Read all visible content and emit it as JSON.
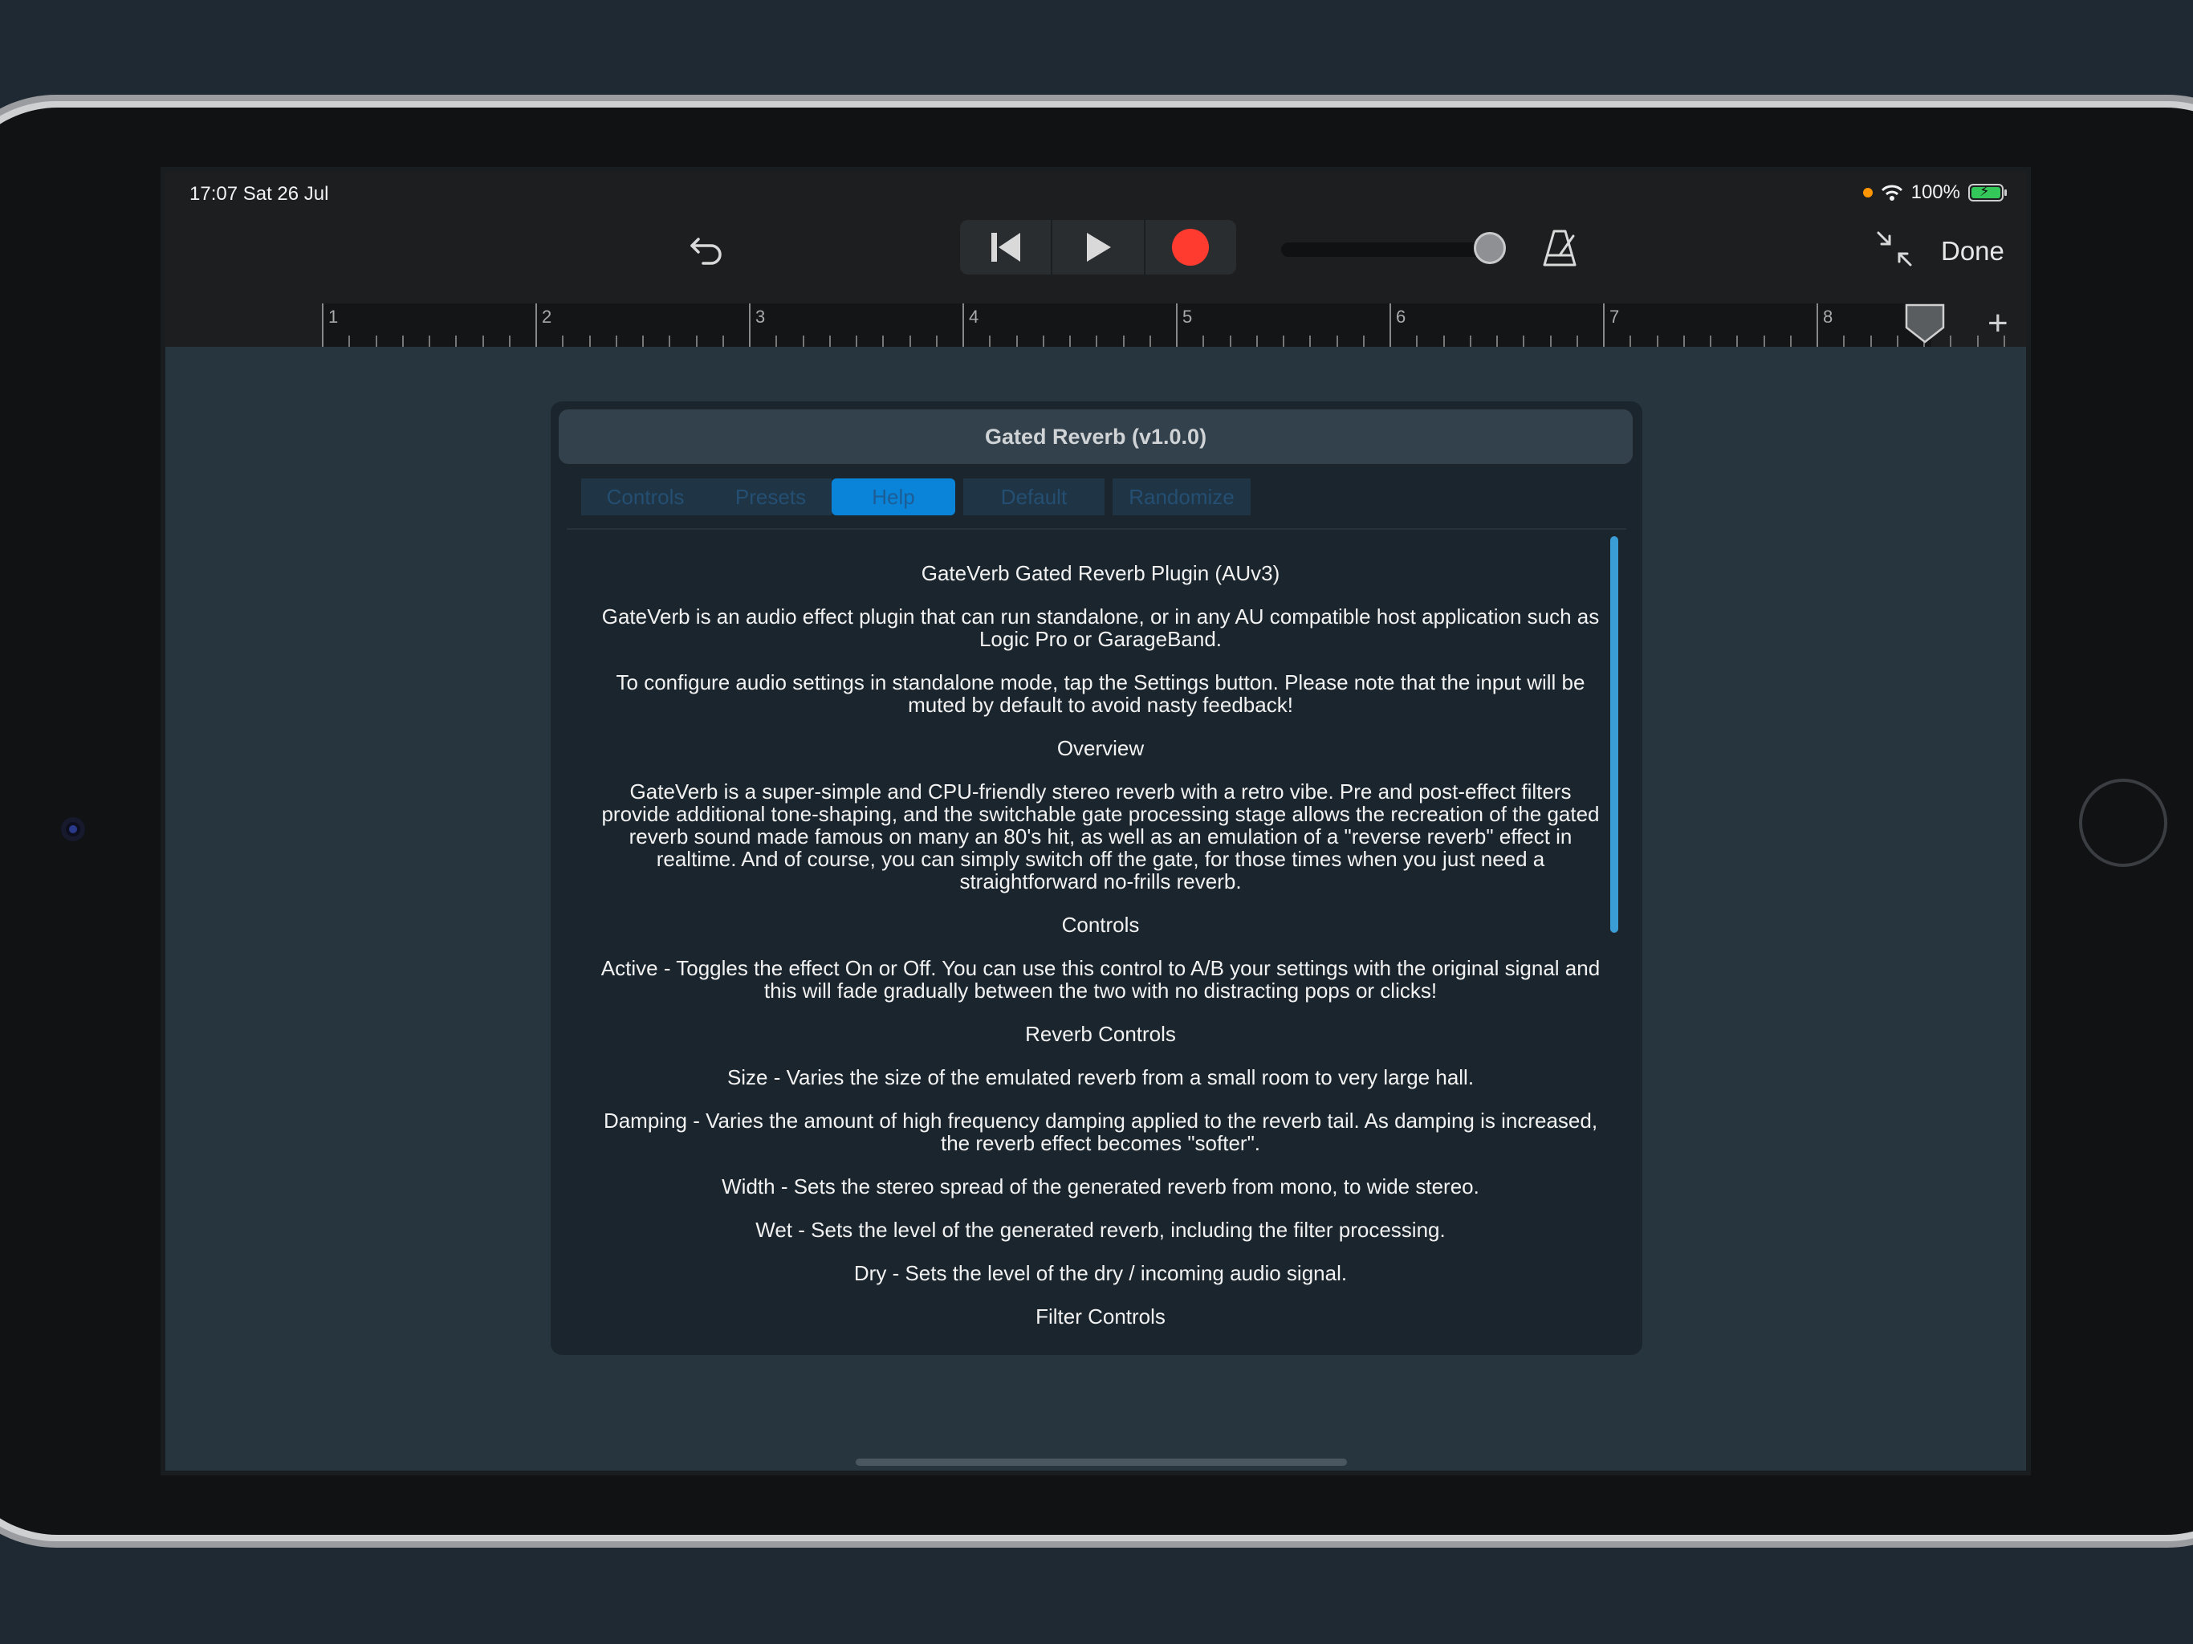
{
  "status_bar": {
    "time_date": "17:07  Sat 26 Jul",
    "battery": "100%"
  },
  "toolbar": {
    "done_label": "Done",
    "volume_level": 0.9,
    "icons": [
      "undo-icon",
      "skip-back-icon",
      "play-icon",
      "record-icon",
      "metronome-icon",
      "collapse-icon"
    ]
  },
  "ruler": {
    "bars": [
      "1",
      "2",
      "3",
      "4",
      "5",
      "6",
      "7",
      "8"
    ],
    "add_label": "+"
  },
  "plugin": {
    "title": "Gated Reverb (v1.0.0)",
    "tabs": [
      {
        "label": "Controls"
      },
      {
        "label": "Presets"
      },
      {
        "label": "Help"
      },
      {
        "label": "Default"
      },
      {
        "label": "Randomize"
      }
    ],
    "active_tab": "Help",
    "help": [
      "GateVerb Gated Reverb Plugin (AUv3)",
      "GateVerb is an audio effect plugin that can run standalone, or in any AU compatible host application such as Logic Pro or GarageBand.",
      "To configure audio settings in standalone mode, tap the Settings button. Please note that the input will be muted by default to avoid nasty feedback!",
      "Overview",
      "GateVerb is a super-simple and CPU-friendly stereo reverb with a retro vibe. Pre and post-effect filters provide additional tone-shaping, and the switchable gate processing stage allows the recreation of the gated reverb sound made famous on many an 80's hit, as well as an emulation of a \"reverse reverb\" effect in realtime. And of course, you can simply switch off the gate, for those times when you just need a straightforward no-frills reverb.",
      "Controls",
      "Active - Toggles the effect On or Off. You can use this control to A/B your settings with the original signal and this will fade gradually between the two with no distracting pops or clicks!",
      "Reverb Controls",
      "Size - Varies the size of the emulated reverb from a small room to very large hall.",
      "Damping - Varies the amount of high frequency damping applied to the reverb tail. As damping is increased, the reverb effect becomes \"softer\".",
      "Width - Sets the stereo spread of the generated reverb from mono, to wide stereo.",
      "Wet - Sets the level of the generated reverb, including the filter processing.",
      "Dry - Sets the level of the dry / incoming audio signal.",
      "Filter Controls"
    ]
  },
  "colors": {
    "accent": "#0a84d8",
    "record": "#ff3b30",
    "scrollbar": "#3b9dd6"
  }
}
